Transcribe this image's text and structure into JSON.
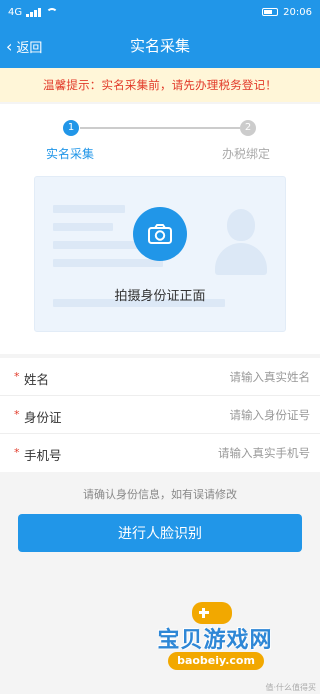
{
  "status_bar": {
    "time": "20:06",
    "network": "4G"
  },
  "nav": {
    "back_label": "返回",
    "title": "实名采集"
  },
  "notice": "温馨提示：实名采集前，请先办理税务登记！",
  "steps": [
    {
      "number": "1",
      "label": "实名采集"
    },
    {
      "number": "2",
      "label": "办税绑定"
    }
  ],
  "id_card": {
    "hint": "拍摄身份证正面"
  },
  "form": {
    "rows": [
      {
        "required": "*",
        "label": "姓名",
        "placeholder": "请输入真实姓名"
      },
      {
        "required": "*",
        "label": "身份证",
        "placeholder": "请输入身份证号"
      },
      {
        "required": "*",
        "label": "手机号",
        "placeholder": "请输入真实手机号"
      }
    ]
  },
  "confirm_text": "请确认身份信息，如有误请修改",
  "face_button": "进行人脸识别",
  "watermark": {
    "title": "宝贝游戏网",
    "url": "baobeiy.com",
    "corner": "值·什么值得买"
  },
  "colors": {
    "primary": "#2196e8",
    "notice_bg": "#fff6d8",
    "notice_text": "#e23b2a",
    "inactive": "#cccccc"
  }
}
